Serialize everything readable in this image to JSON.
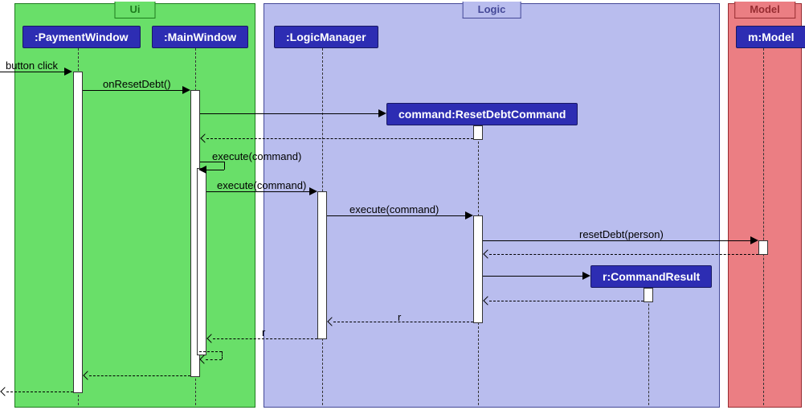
{
  "regions": {
    "ui": "Ui",
    "logic": "Logic",
    "model": "Model"
  },
  "participants": {
    "paymentWindow": ":PaymentWindow",
    "mainWindow": ":MainWindow",
    "logicManager": ":LogicManager",
    "resetDebtCommand": "command:ResetDebtCommand",
    "commandResult": "r:CommandResult",
    "mModel": "m:Model"
  },
  "messages": {
    "buttonClick": "button click",
    "onResetDebt": "onResetDebt()",
    "executeCommand1": "execute(command)",
    "executeCommand2": "execute(command)",
    "executeCommand3": "execute(command)",
    "resetDebtPerson": "resetDebt(person)",
    "r1": "r",
    "r2": "r"
  },
  "chart_data": {
    "type": "sequence-diagram",
    "regions": [
      {
        "name": "Ui",
        "participants": [
          ":PaymentWindow",
          ":MainWindow"
        ]
      },
      {
        "name": "Logic",
        "participants": [
          ":LogicManager",
          "command:ResetDebtCommand",
          "r:CommandResult"
        ]
      },
      {
        "name": "Model",
        "participants": [
          "m:Model"
        ]
      }
    ],
    "messages": [
      {
        "from": "actor",
        "to": ":PaymentWindow",
        "label": "button click",
        "type": "sync"
      },
      {
        "from": ":PaymentWindow",
        "to": ":MainWindow",
        "label": "onResetDebt()",
        "type": "sync"
      },
      {
        "from": ":MainWindow",
        "to": "command:ResetDebtCommand",
        "label": "",
        "type": "create"
      },
      {
        "from": "command:ResetDebtCommand",
        "to": ":MainWindow",
        "label": "",
        "type": "return"
      },
      {
        "from": ":MainWindow",
        "to": ":MainWindow",
        "label": "execute(command)",
        "type": "self"
      },
      {
        "from": ":MainWindow",
        "to": ":LogicManager",
        "label": "execute(command)",
        "type": "sync"
      },
      {
        "from": ":LogicManager",
        "to": "command:ResetDebtCommand",
        "label": "execute(command)",
        "type": "sync"
      },
      {
        "from": "command:ResetDebtCommand",
        "to": "m:Model",
        "label": "resetDebt(person)",
        "type": "sync"
      },
      {
        "from": "m:Model",
        "to": "command:ResetDebtCommand",
        "label": "",
        "type": "return"
      },
      {
        "from": "command:ResetDebtCommand",
        "to": "r:CommandResult",
        "label": "",
        "type": "create"
      },
      {
        "from": "r:CommandResult",
        "to": "command:ResetDebtCommand",
        "label": "",
        "type": "return"
      },
      {
        "from": "command:ResetDebtCommand",
        "to": ":LogicManager",
        "label": "r",
        "type": "return"
      },
      {
        "from": ":LogicManager",
        "to": ":MainWindow",
        "label": "r",
        "type": "return"
      },
      {
        "from": ":MainWindow",
        "to": ":MainWindow",
        "label": "",
        "type": "self-return"
      },
      {
        "from": ":MainWindow",
        "to": ":PaymentWindow",
        "label": "",
        "type": "return"
      },
      {
        "from": ":PaymentWindow",
        "to": "actor",
        "label": "",
        "type": "return"
      }
    ]
  }
}
